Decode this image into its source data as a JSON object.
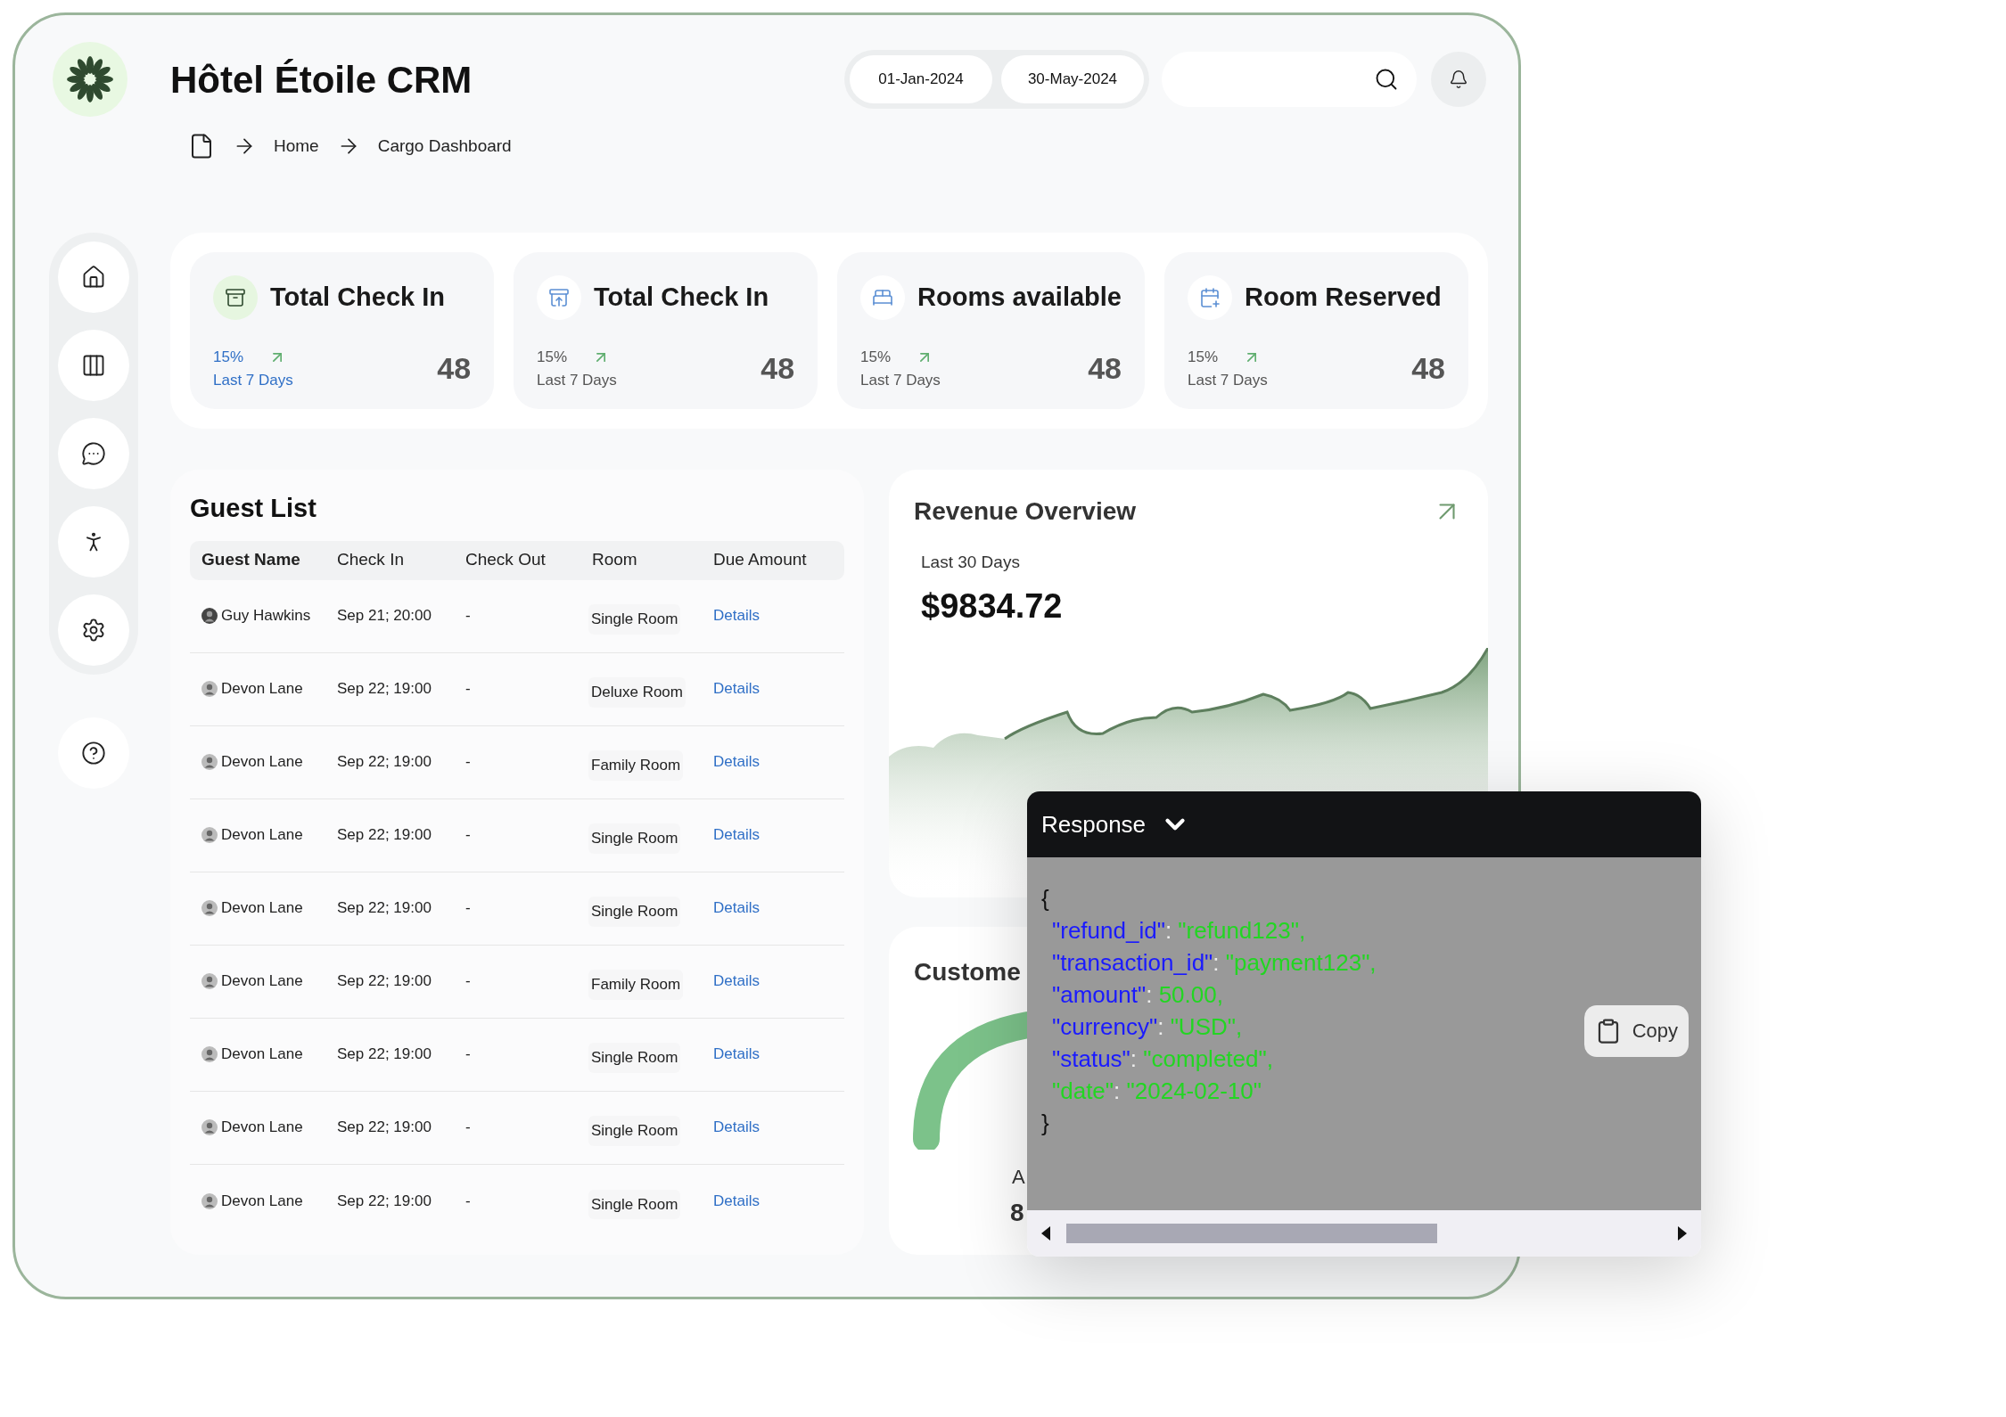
{
  "app": {
    "title": "Hôtel Étoile CRM"
  },
  "date_range": {
    "start": "01-Jan-2024",
    "end": "30-May-2024"
  },
  "breadcrumb": [
    "Home",
    "Cargo Dashboard"
  ],
  "sidebar": {
    "items": [
      {
        "kind": "home"
      },
      {
        "kind": "columns"
      },
      {
        "kind": "chat"
      },
      {
        "kind": "accessibility"
      },
      {
        "kind": "settings"
      }
    ],
    "help": {
      "kind": "help"
    }
  },
  "stats": [
    {
      "kind": "checkin",
      "title": "Total Check In",
      "change": "15%",
      "period": "Last 7 Days",
      "value": "48",
      "selected": true
    },
    {
      "kind": "checkout",
      "title": "Total Check In",
      "change": "15%",
      "period": "Last 7 Days",
      "value": "48",
      "selected": false
    },
    {
      "kind": "bed",
      "title": "Rooms available",
      "change": "15%",
      "period": "Last 7 Days",
      "value": "48",
      "selected": false
    },
    {
      "kind": "calendar",
      "title": "Room Reserved",
      "change": "15%",
      "period": "Last 7 Days",
      "value": "48",
      "selected": false
    }
  ],
  "guest_list": {
    "title": "Guest List",
    "columns": [
      "Guest Name",
      "Check In",
      "Check Out",
      "Room",
      "Due Amount"
    ],
    "rows": [
      {
        "name": "Guy Hawkins",
        "check_in": "Sep 21; 20:00",
        "check_out": "-",
        "room": "Single Room",
        "due": "Details"
      },
      {
        "name": "Devon Lane",
        "check_in": "Sep 22; 19:00",
        "check_out": "-",
        "room": "Deluxe Room",
        "due": "Details"
      },
      {
        "name": "Devon Lane",
        "check_in": "Sep 22; 19:00",
        "check_out": "-",
        "room": "Family Room",
        "due": "Details"
      },
      {
        "name": "Devon Lane",
        "check_in": "Sep 22; 19:00",
        "check_out": "-",
        "room": "Single Room",
        "due": "Details"
      },
      {
        "name": "Devon Lane",
        "check_in": "Sep 22; 19:00",
        "check_out": "-",
        "room": "Single Room",
        "due": "Details"
      },
      {
        "name": "Devon Lane",
        "check_in": "Sep 22; 19:00",
        "check_out": "-",
        "room": "Family Room",
        "due": "Details"
      },
      {
        "name": "Devon Lane",
        "check_in": "Sep 22; 19:00",
        "check_out": "-",
        "room": "Single Room",
        "due": "Details"
      },
      {
        "name": "Devon Lane",
        "check_in": "Sep 22; 19:00",
        "check_out": "-",
        "room": "Single Room",
        "due": "Details"
      },
      {
        "name": "Devon Lane",
        "check_in": "Sep 22; 19:00",
        "check_out": "-",
        "room": "Single Room",
        "due": "Details"
      }
    ]
  },
  "revenue": {
    "title": "Revenue Overview",
    "period": "Last 30 Days",
    "amount": "$9834.72"
  },
  "customers": {
    "title": "Custome",
    "label": "A",
    "value": "8"
  },
  "response": {
    "title": "Response",
    "open_brace": "{",
    "close_brace": "}",
    "lines": [
      {
        "key": "\"refund_id\"",
        "sep": ":",
        "value": "\"refund123\",",
        "color": "#1a1aff"
      },
      {
        "key": "\"transaction_id\"",
        "sep": ":",
        "value": "\"payment123\",",
        "color": "#1a1aff"
      },
      {
        "key": "\"amount\"",
        "sep": ":",
        "value": "50.00,",
        "color": "#1a1aff"
      },
      {
        "key": "\"currency\"",
        "sep": ":",
        "value": "\"USD\",",
        "color": "#1a1aff"
      },
      {
        "key": "\"status\"",
        "sep": ":",
        "value": "\"completed\",",
        "color": "#1a1aff"
      },
      {
        "key": "\"date\"",
        "sep": ":",
        "value": "\"2024-02-10\"",
        "color": "#22d622"
      }
    ],
    "copy": "Copy"
  }
}
